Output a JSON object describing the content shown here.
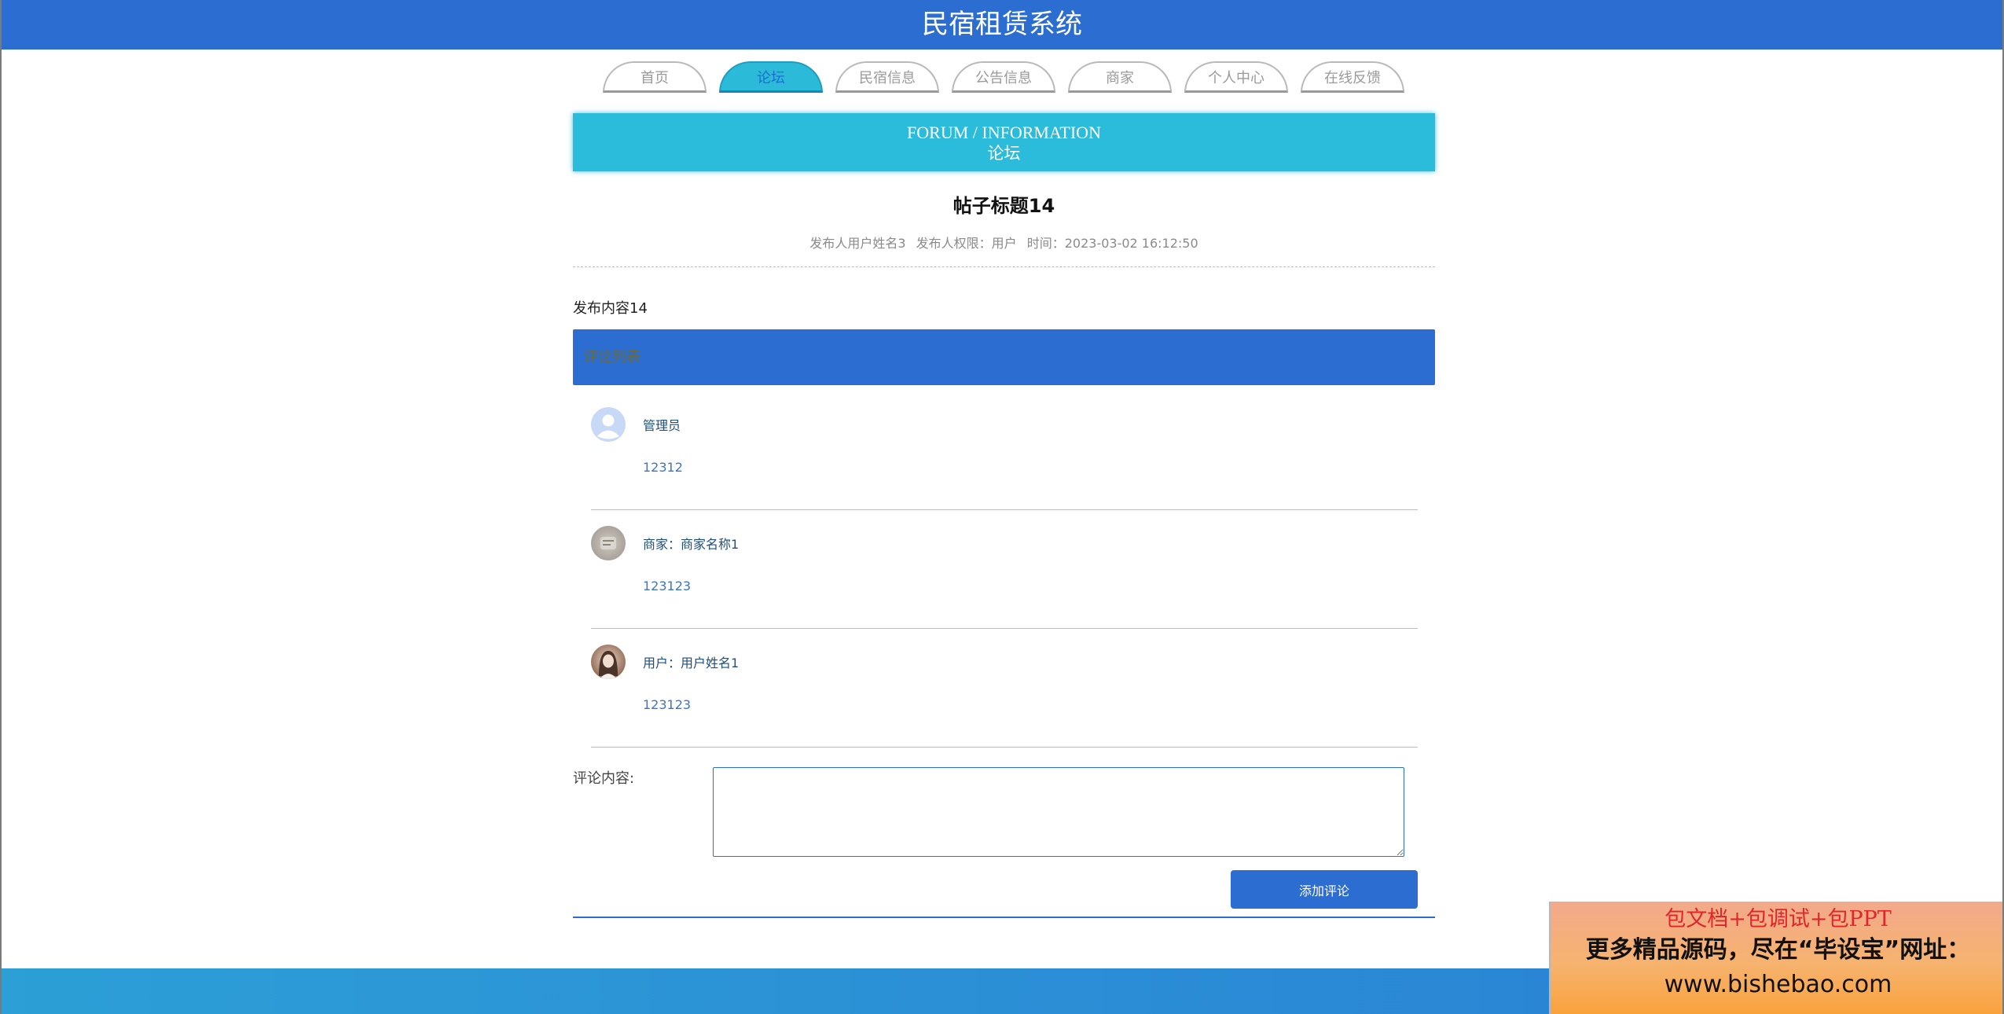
{
  "header": {
    "title": "民宿租赁系统"
  },
  "nav": {
    "items": [
      {
        "label": "首页"
      },
      {
        "label": "论坛"
      },
      {
        "label": "民宿信息"
      },
      {
        "label": "公告信息"
      },
      {
        "label": "商家"
      },
      {
        "label": "个人中心"
      },
      {
        "label": "在线反馈"
      }
    ],
    "active": "论坛"
  },
  "banner": {
    "en": "FORUM / INFORMATION",
    "cn": "论坛"
  },
  "post": {
    "title": "帖子标题14",
    "meta": {
      "author": "发布人用户姓名3",
      "role": "发布人权限：用户",
      "time": "时间：2023-03-02 16:12:50"
    },
    "content": "发布内容14"
  },
  "comments": {
    "header": "评论列表",
    "items": [
      {
        "avatar": "admin-avatar",
        "name": "管理员",
        "text": "12312"
      },
      {
        "avatar": "merchant-avatar",
        "name": "商家：商家名称1",
        "text": "123123"
      },
      {
        "avatar": "user-avatar",
        "name": "用户：用户姓名1",
        "text": "123123"
      }
    ]
  },
  "form": {
    "label": "评论内容:",
    "value": "",
    "submit_label": "添加评论"
  },
  "ad": {
    "line1": "包文档+包调试+包PPT",
    "line2": "更多精品源码，尽在“毕设宝”网址：",
    "line3": "www.bishebao.com"
  },
  "colors": {
    "primary": "#2b6dd1",
    "accent": "#2bbbdb"
  }
}
